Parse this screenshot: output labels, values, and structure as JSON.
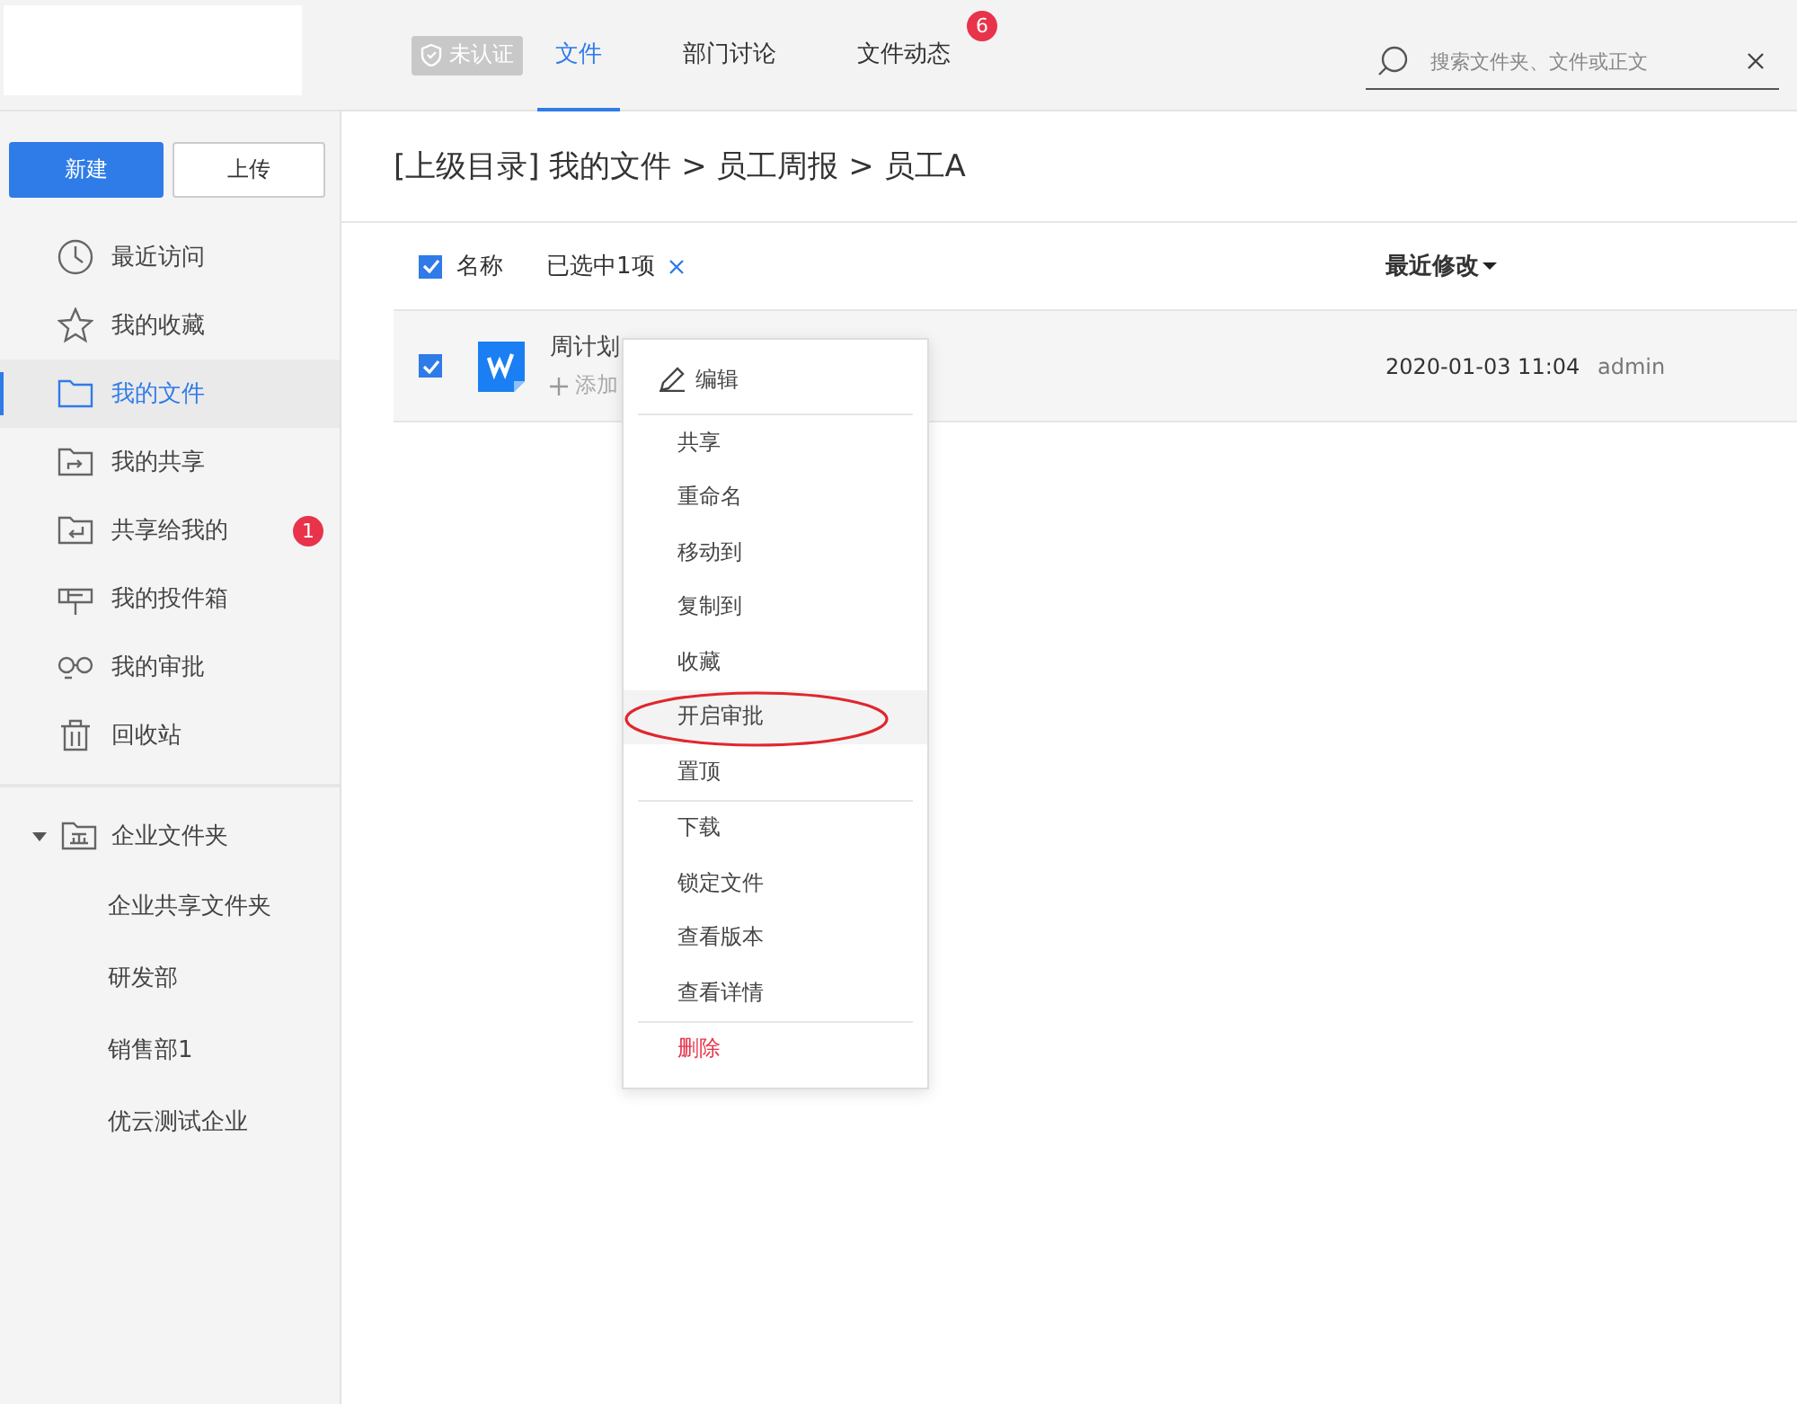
{
  "header": {
    "badge": "未认证",
    "tabs": [
      {
        "label": "文件",
        "selected": true
      },
      {
        "label": "部门讨论",
        "selected": false
      },
      {
        "label": "文件动态",
        "selected": false,
        "count": "6"
      }
    ],
    "search": {
      "placeholder": "搜索文件夹、文件或正文"
    }
  },
  "sidebar": {
    "buttons": [
      {
        "label": "新建",
        "kind": "primary"
      },
      {
        "label": "上传",
        "kind": "secondary"
      }
    ],
    "items": [
      {
        "label": "最近访问",
        "selected": false
      },
      {
        "label": "我的收藏",
        "selected": false
      },
      {
        "label": "我的文件",
        "selected": true
      },
      {
        "label": "我的共享",
        "selected": false
      },
      {
        "label": "共享给我的",
        "selected": false,
        "count": "1"
      },
      {
        "label": "我的投件箱",
        "selected": false
      },
      {
        "label": "我的审批",
        "selected": false
      },
      {
        "label": "回收站",
        "selected": false
      }
    ],
    "tree": {
      "label": "企业文件夹",
      "expanded": true,
      "children": [
        {
          "label": "企业共享文件夹"
        },
        {
          "label": "研发部"
        },
        {
          "label": "销售部1"
        },
        {
          "label": "优云测试企业"
        }
      ]
    }
  },
  "breadcrumb": "[上级目录] 我的文件 > 员工周报 > 员工A",
  "table": {
    "all_checked": true,
    "columns": [
      "名称",
      "最近修改"
    ],
    "selection_text": "已选中1项",
    "rows": [
      {
        "name": "周计划",
        "tag_action": "添加",
        "modified": "2020-01-03 11:04",
        "owner": "admin",
        "checked": true
      }
    ]
  },
  "context_menu": {
    "groups": [
      [
        {
          "label": "编辑",
          "kind": "edit",
          "hovered": false
        }
      ],
      [
        {
          "label": "共享",
          "kind": "plain",
          "hovered": false
        },
        {
          "label": "重命名",
          "kind": "plain",
          "hovered": false
        },
        {
          "label": "移动到",
          "kind": "plain",
          "hovered": false
        },
        {
          "label": "复制到",
          "kind": "plain",
          "hovered": false
        },
        {
          "label": "收藏",
          "kind": "plain",
          "hovered": false
        },
        {
          "label": "开启审批",
          "kind": "plain",
          "hovered": true,
          "circled": true
        },
        {
          "label": "置顶",
          "kind": "plain",
          "hovered": false
        }
      ],
      [
        {
          "label": "下载",
          "kind": "plain",
          "hovered": false
        },
        {
          "label": "锁定文件",
          "kind": "plain",
          "hovered": false
        },
        {
          "label": "查看版本",
          "kind": "plain",
          "hovered": false
        },
        {
          "label": "查看详情",
          "kind": "plain",
          "hovered": false
        }
      ],
      [
        {
          "label": "删除",
          "kind": "danger",
          "hovered": false
        }
      ]
    ]
  }
}
